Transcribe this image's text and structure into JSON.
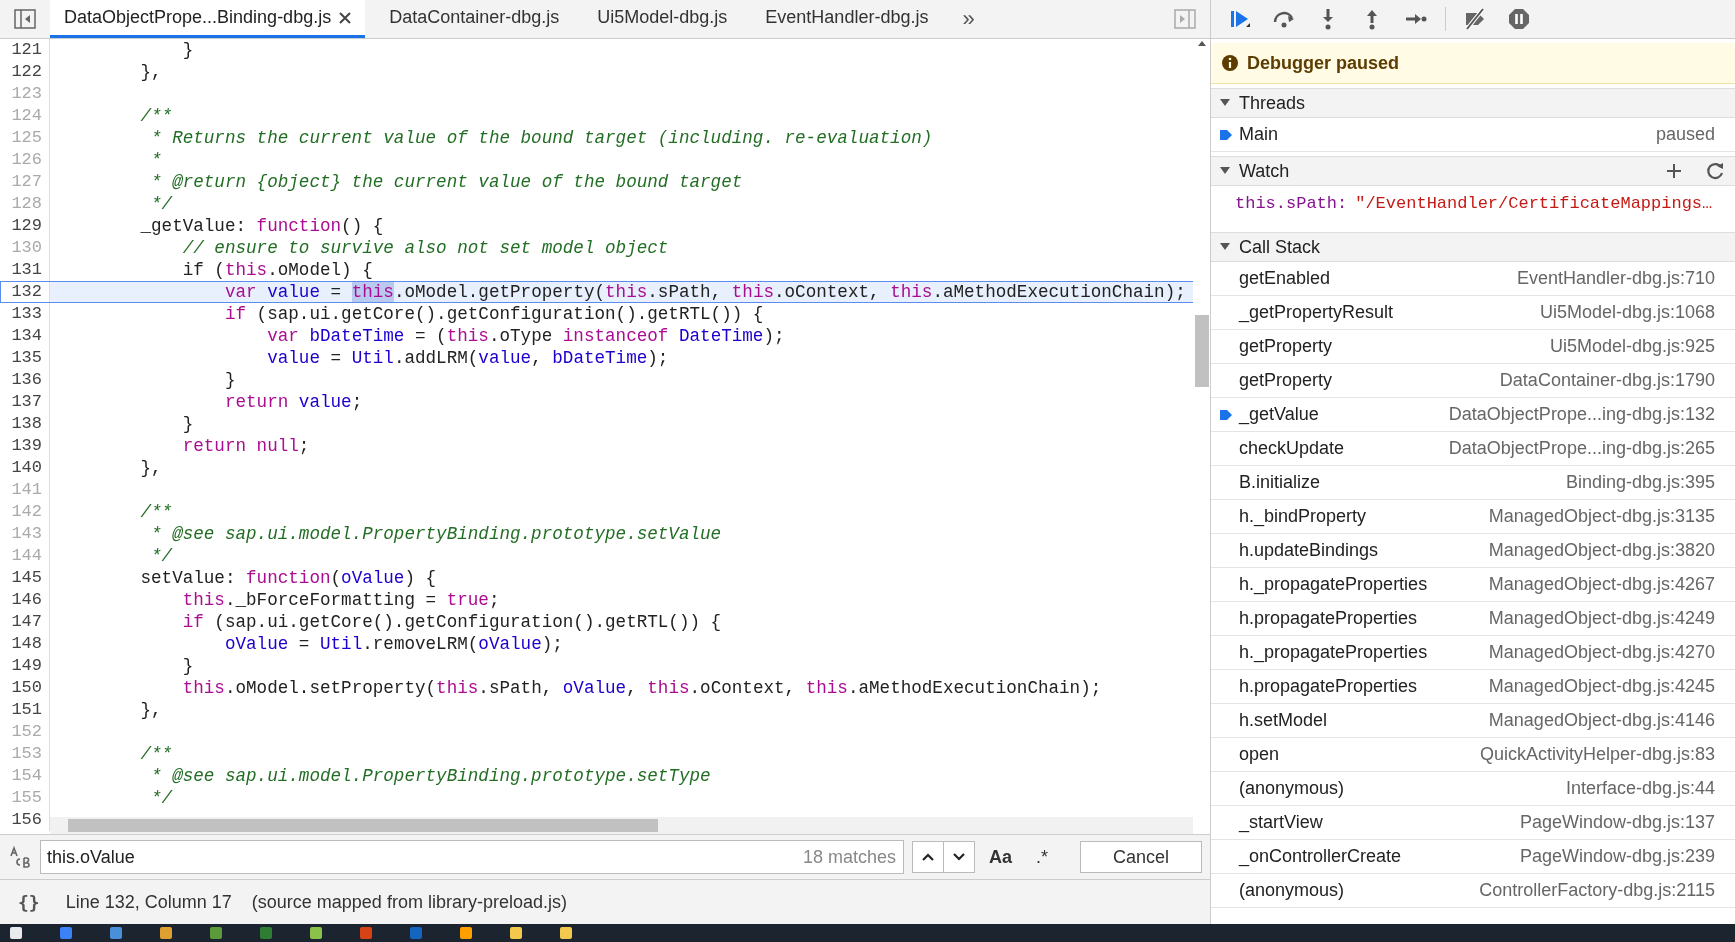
{
  "editor_tabs": [
    {
      "label": "DataObjectPrope...Binding-dbg.js",
      "selected": true,
      "closable": true
    },
    {
      "label": "DataContainer-dbg.js",
      "selected": false,
      "closable": false
    },
    {
      "label": "Ui5Model-dbg.js",
      "selected": false,
      "closable": false
    },
    {
      "label": "EventHandler-dbg.js",
      "selected": false,
      "closable": false
    }
  ],
  "tabs_overflow": "»",
  "code": {
    "lines": [
      {
        "number": "121",
        "dimmed": false,
        "selected": false,
        "segments": [
          {
            "text": "            }",
            "kind": "plain"
          }
        ]
      },
      {
        "number": "122",
        "dimmed": false,
        "selected": false,
        "segments": [
          {
            "text": "        },",
            "kind": "plain"
          }
        ]
      },
      {
        "number": "123",
        "dimmed": true,
        "selected": false
      },
      {
        "number": "124",
        "dimmed": true,
        "selected": false,
        "segments": [
          {
            "text": "        /**",
            "kind": "comment"
          }
        ]
      },
      {
        "number": "125",
        "dimmed": true,
        "selected": false,
        "segments": [
          {
            "text": "         * Returns the current value of the bound target (including. re-evaluation)",
            "kind": "comment"
          }
        ]
      },
      {
        "number": "126",
        "dimmed": true,
        "selected": false,
        "segments": [
          {
            "text": "         *",
            "kind": "comment"
          }
        ]
      },
      {
        "number": "127",
        "dimmed": true,
        "selected": false,
        "segments": [
          {
            "text": "         * @return {object} the current value of the bound target",
            "kind": "comment"
          }
        ]
      },
      {
        "number": "128",
        "dimmed": true,
        "selected": false,
        "segments": [
          {
            "text": "         */",
            "kind": "comment"
          }
        ]
      },
      {
        "number": "129",
        "dimmed": false,
        "selected": false,
        "segments": [
          {
            "text": "        _getValue: ",
            "kind": "plain"
          },
          {
            "text": "function",
            "kind": "keyword"
          },
          {
            "text": "() {",
            "kind": "plain"
          }
        ]
      },
      {
        "number": "130",
        "dimmed": true,
        "selected": false,
        "segments": [
          {
            "text": "            // ensure to survive also not set model object",
            "kind": "comment"
          }
        ]
      },
      {
        "number": "131",
        "dimmed": false,
        "selected": false,
        "segments": [
          {
            "text": "            if (",
            "kind": "plain"
          },
          {
            "text": "this",
            "kind": "keyword"
          },
          {
            "text": ".oModel) {",
            "kind": "plain"
          }
        ]
      },
      {
        "number": "132",
        "dimmed": false,
        "selected": true,
        "segments": [
          {
            "text": "                var ",
            "kind": "keyword"
          },
          {
            "text": "value",
            "kind": "variable"
          },
          {
            "text": " = ",
            "kind": "plain"
          },
          {
            "text": "this",
            "kind": "match"
          },
          {
            "text": ".oModel.getProperty(",
            "kind": "plain"
          },
          {
            "text": "this",
            "kind": "keyword"
          },
          {
            "text": ".sPath, ",
            "kind": "plain"
          },
          {
            "text": "this",
            "kind": "keyword"
          },
          {
            "text": ".oContext, ",
            "kind": "plain"
          },
          {
            "text": "this",
            "kind": "keyword"
          },
          {
            "text": ".aMethodExecutionChain);",
            "kind": "plain"
          }
        ]
      },
      {
        "number": "133",
        "dimmed": false,
        "selected": false,
        "segments": [
          {
            "text": "                if",
            "kind": "keyword"
          },
          {
            "text": " (sap.ui.getCore().getConfiguration().getRTL()) {",
            "kind": "plain"
          }
        ]
      },
      {
        "number": "134",
        "dimmed": false,
        "selected": false,
        "segments": [
          {
            "text": "                    var ",
            "kind": "keyword"
          },
          {
            "text": "bDateTime",
            "kind": "variable"
          },
          {
            "text": " = (",
            "kind": "plain"
          },
          {
            "text": "this",
            "kind": "keyword"
          },
          {
            "text": ".oType ",
            "kind": "plain"
          },
          {
            "text": "instanceof ",
            "kind": "keyword"
          },
          {
            "text": "DateTime",
            "kind": "variable"
          },
          {
            "text": ");",
            "kind": "plain"
          }
        ]
      },
      {
        "number": "135",
        "dimmed": false,
        "selected": false,
        "segments": [
          {
            "text": "                    value",
            "kind": "variable"
          },
          {
            "text": " = ",
            "kind": "plain"
          },
          {
            "text": "Util",
            "kind": "variable"
          },
          {
            "text": ".addLRM(",
            "kind": "plain"
          },
          {
            "text": "value",
            "kind": "variable"
          },
          {
            "text": ", ",
            "kind": "plain"
          },
          {
            "text": "bDateTime",
            "kind": "variable"
          },
          {
            "text": ");",
            "kind": "plain"
          }
        ]
      },
      {
        "number": "136",
        "dimmed": false,
        "selected": false,
        "segments": [
          {
            "text": "                }",
            "kind": "plain"
          }
        ]
      },
      {
        "number": "137",
        "dimmed": false,
        "selected": false,
        "segments": [
          {
            "text": "                return ",
            "kind": "keyword"
          },
          {
            "text": "value",
            "kind": "variable"
          },
          {
            "text": ";",
            "kind": "plain"
          }
        ]
      },
      {
        "number": "138",
        "dimmed": false,
        "selected": false,
        "segments": [
          {
            "text": "            }",
            "kind": "plain"
          }
        ]
      },
      {
        "number": "139",
        "dimmed": false,
        "selected": false,
        "segments": [
          {
            "text": "            return ",
            "kind": "keyword"
          },
          {
            "text": "null",
            "kind": "keyword"
          },
          {
            "text": ";",
            "kind": "plain"
          }
        ]
      },
      {
        "number": "140",
        "dimmed": false,
        "selected": false,
        "segments": [
          {
            "text": "        },",
            "kind": "plain"
          }
        ]
      },
      {
        "number": "141",
        "dimmed": true,
        "selected": false
      },
      {
        "number": "142",
        "dimmed": true,
        "selected": false,
        "segments": [
          {
            "text": "        /**",
            "kind": "comment"
          }
        ]
      },
      {
        "number": "143",
        "dimmed": true,
        "selected": false,
        "segments": [
          {
            "text": "         * @see sap.ui.model.PropertyBinding.prototype.setValue",
            "kind": "comment"
          }
        ]
      },
      {
        "number": "144",
        "dimmed": true,
        "selected": false,
        "segments": [
          {
            "text": "         */",
            "kind": "comment"
          }
        ]
      },
      {
        "number": "145",
        "dimmed": false,
        "selected": false,
        "segments": [
          {
            "text": "        setValue: ",
            "kind": "plain"
          },
          {
            "text": "function",
            "kind": "keyword"
          },
          {
            "text": "(",
            "kind": "plain"
          },
          {
            "text": "oValue",
            "kind": "variable"
          },
          {
            "text": ") {",
            "kind": "plain"
          }
        ]
      },
      {
        "number": "146",
        "dimmed": false,
        "selected": false,
        "segments": [
          {
            "text": "            this",
            "kind": "keyword"
          },
          {
            "text": "._bForceFormatting = ",
            "kind": "plain"
          },
          {
            "text": "true",
            "kind": "keyword"
          },
          {
            "text": ";",
            "kind": "plain"
          }
        ]
      },
      {
        "number": "147",
        "dimmed": false,
        "selected": false,
        "segments": [
          {
            "text": "            if",
            "kind": "keyword"
          },
          {
            "text": " (sap.ui.getCore().getConfiguration().getRTL()) {",
            "kind": "plain"
          }
        ]
      },
      {
        "number": "148",
        "dimmed": false,
        "selected": false,
        "segments": [
          {
            "text": "                oValue",
            "kind": "variable"
          },
          {
            "text": " = ",
            "kind": "plain"
          },
          {
            "text": "Util",
            "kind": "variable"
          },
          {
            "text": ".removeLRM(",
            "kind": "plain"
          },
          {
            "text": "oValue",
            "kind": "variable"
          },
          {
            "text": ");",
            "kind": "plain"
          }
        ]
      },
      {
        "number": "149",
        "dimmed": false,
        "selected": false,
        "segments": [
          {
            "text": "            }",
            "kind": "plain"
          }
        ]
      },
      {
        "number": "150",
        "dimmed": false,
        "selected": false,
        "segments": [
          {
            "text": "            this",
            "kind": "keyword"
          },
          {
            "text": ".oModel.setProperty(",
            "kind": "plain"
          },
          {
            "text": "this",
            "kind": "keyword"
          },
          {
            "text": ".sPath, ",
            "kind": "plain"
          },
          {
            "text": "oValue",
            "kind": "variable"
          },
          {
            "text": ", ",
            "kind": "plain"
          },
          {
            "text": "this",
            "kind": "keyword"
          },
          {
            "text": ".oContext, ",
            "kind": "plain"
          },
          {
            "text": "this",
            "kind": "keyword"
          },
          {
            "text": ".aMethodExecutionChain);",
            "kind": "plain"
          }
        ]
      },
      {
        "number": "151",
        "dimmed": false,
        "selected": false,
        "segments": [
          {
            "text": "        },",
            "kind": "plain"
          }
        ]
      },
      {
        "number": "152",
        "dimmed": true,
        "selected": false
      },
      {
        "number": "153",
        "dimmed": true,
        "selected": false,
        "segments": [
          {
            "text": "        /**",
            "kind": "comment"
          }
        ]
      },
      {
        "number": "154",
        "dimmed": true,
        "selected": false,
        "segments": [
          {
            "text": "         * @see sap.ui.model.PropertyBinding.prototype.setType",
            "kind": "comment"
          }
        ]
      },
      {
        "number": "155",
        "dimmed": true,
        "selected": false,
        "segments": [
          {
            "text": "         */",
            "kind": "comment"
          }
        ]
      },
      {
        "number": "156",
        "dimmed": false,
        "selected": false
      }
    ]
  },
  "search": {
    "value": "this.oValue",
    "matches": "18 matches",
    "case_button": "Aa",
    "regex_button": ".*",
    "cancel_button": "Cancel"
  },
  "status_bar": {
    "pretty_print": "{}",
    "position": "Line 132, Column 17",
    "source_note": "(source mapped from library-preload.js)"
  },
  "debugger": {
    "banner": "Debugger paused",
    "threads": {
      "title": "Threads",
      "expanded": true,
      "items": [
        {
          "name": "Main",
          "status": "paused",
          "selected": true
        }
      ]
    },
    "watch": {
      "title": "Watch",
      "expanded": true,
      "items": [
        {
          "expression": "this.sPath:",
          "value": "\"/EventHandler/CertificateMappings…"
        }
      ]
    },
    "call_stack": {
      "title": "Call Stack",
      "expanded": true,
      "frames": [
        {
          "function": "getEnabled",
          "location": "EventHandler-dbg.js:710",
          "selected": false
        },
        {
          "function": "_getPropertyResult",
          "location": "Ui5Model-dbg.js:1068",
          "selected": false
        },
        {
          "function": "getProperty",
          "location": "Ui5Model-dbg.js:925",
          "selected": false
        },
        {
          "function": "getProperty",
          "location": "DataContainer-dbg.js:1790",
          "selected": false
        },
        {
          "function": "_getValue",
          "location": "DataObjectPrope...ing-dbg.js:132",
          "selected": true
        },
        {
          "function": "checkUpdate",
          "location": "DataObjectPrope...ing-dbg.js:265",
          "selected": false
        },
        {
          "function": "B.initialize",
          "location": "Binding-dbg.js:395",
          "selected": false
        },
        {
          "function": "h._bindProperty",
          "location": "ManagedObject-dbg.js:3135",
          "selected": false
        },
        {
          "function": "h.updateBindings",
          "location": "ManagedObject-dbg.js:3820",
          "selected": false
        },
        {
          "function": "h._propagateProperties",
          "location": "ManagedObject-dbg.js:4267",
          "selected": false
        },
        {
          "function": "h.propagateProperties",
          "location": "ManagedObject-dbg.js:4249",
          "selected": false
        },
        {
          "function": "h._propagateProperties",
          "location": "ManagedObject-dbg.js:4270",
          "selected": false
        },
        {
          "function": "h.propagateProperties",
          "location": "ManagedObject-dbg.js:4245",
          "selected": false
        },
        {
          "function": "h.setModel",
          "location": "ManagedObject-dbg.js:4146",
          "selected": false
        },
        {
          "function": "open",
          "location": "QuickActivityHelper-dbg.js:83",
          "selected": false
        },
        {
          "function": "(anonymous)",
          "location": "Interface-dbg.js:44",
          "selected": false
        },
        {
          "function": "_startView",
          "location": "PageWindow-dbg.js:137",
          "selected": false
        },
        {
          "function": "_onControllerCreate",
          "location": "PageWindow-dbg.js:239",
          "selected": false
        },
        {
          "function": "(anonymous)",
          "location": "ControllerFactory-dbg.js:2115",
          "selected": false
        }
      ]
    }
  }
}
